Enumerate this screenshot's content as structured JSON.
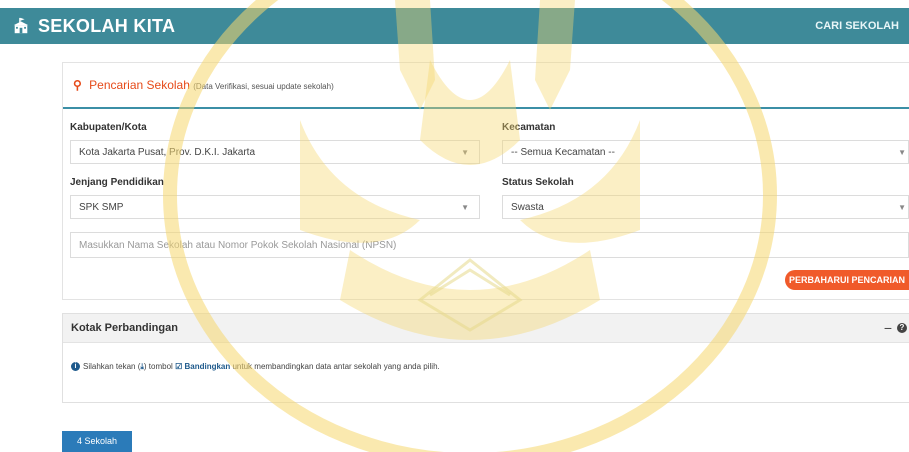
{
  "header": {
    "brand": "SEKOLAH KITA",
    "nav_link": "CARI SEKOLAH"
  },
  "search": {
    "title": "Pencarian Sekolah",
    "subtitle": "(Data Verifikasi, sesuai update sekolah)",
    "kabupaten_label": "Kabupaten/Kota",
    "kabupaten_value": "Kota Jakarta Pusat, Prov. D.K.I. Jakarta",
    "kecamatan_label": "Kecamatan",
    "kecamatan_value": "-- Semua Kecamatan --",
    "jenjang_label": "Jenjang Pendidikan",
    "jenjang_value": "SPK SMP",
    "status_label": "Status Sekolah",
    "status_value": "Swasta",
    "name_placeholder": "Masukkan Nama Sekolah atau Nomor Pokok Sekolah Nasional (NPSN)",
    "refresh_button": "PERBAHARUI PENCARIAN"
  },
  "compare": {
    "title": "Kotak Perbandingan",
    "info_prefix": "Silahkan tekan (",
    "info_icon_glyph": "⤓",
    "info_mid": ") tombol",
    "info_button": "Bandingkan",
    "info_suffix": "untuk membandingkan data antar sekolah yang anda pilih."
  },
  "results": {
    "count_label": "4 Sekolah"
  },
  "colors": {
    "topbar": "#3e8a99",
    "accent_orange": "#f05a2a",
    "title_orange": "#e64a19",
    "badge_blue": "#2b7bb9",
    "watermark_yellow": "#f5d76e"
  },
  "icons": {
    "brand": "school-building-icon",
    "search": "search-icon",
    "caret": "caret-down-icon",
    "info": "info-circle-icon",
    "download": "download-icon",
    "check_square": "check-square-icon",
    "minus": "minus-icon",
    "help": "question-circle-icon"
  }
}
